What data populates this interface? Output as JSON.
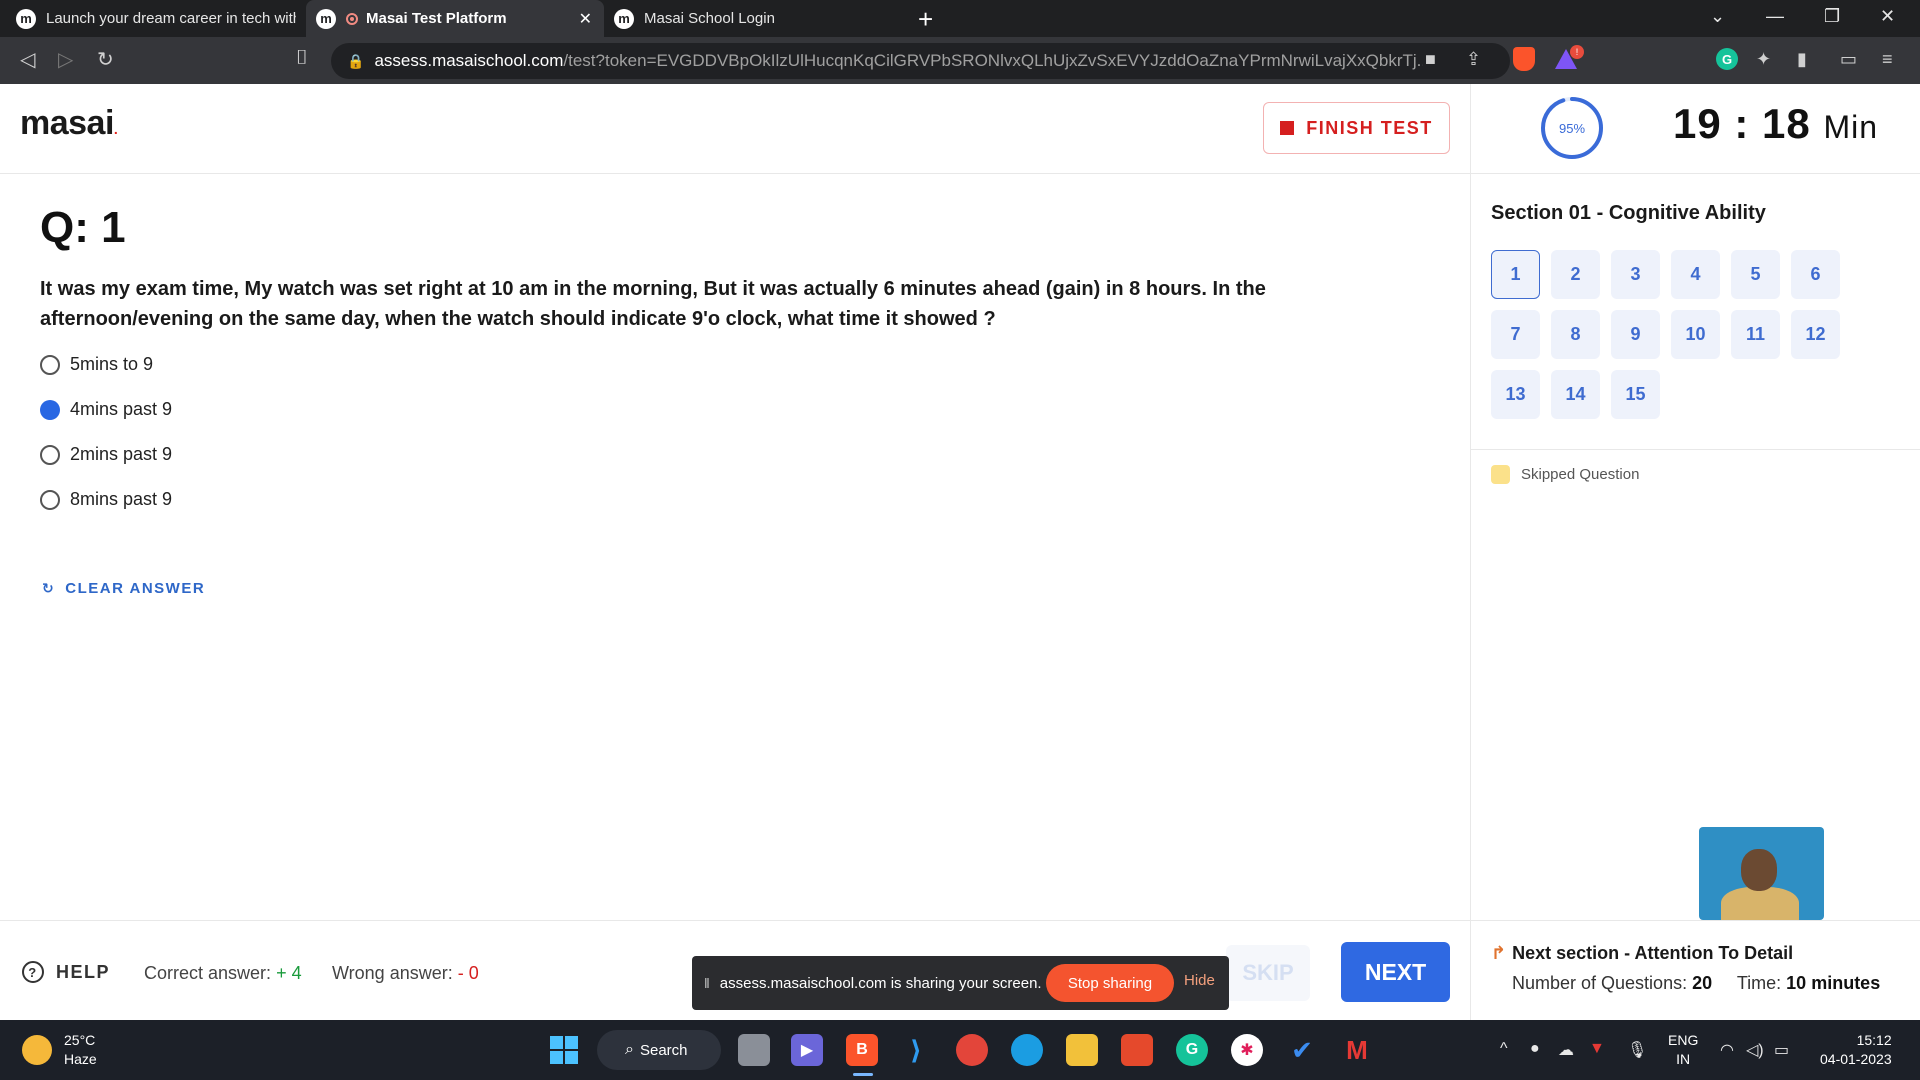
{
  "browser": {
    "tabs": [
      {
        "title": "Launch your dream career in tech with",
        "favicon": "m",
        "active": false
      },
      {
        "title": "Masai Test Platform",
        "favicon": "m",
        "active": true
      },
      {
        "title": "Masai School Login",
        "favicon": "m",
        "active": false
      }
    ],
    "url_host": "assess.masaischool.com",
    "url_path": "/test?token=EVGDDVBpOkIlzUlHucqnKqCilGRVPbSRONlvxQLhUjxZvSxEVYJzddOaZnaYPrmNrwiLvajXxQbkrTj...",
    "new_tab_icon": "plus-icon"
  },
  "header": {
    "logo_text": "masai",
    "finish_label": "FINISH TEST",
    "progress_label": "95%",
    "progress": 0.95,
    "timer_value": "19 : 18",
    "timer_unit": "Min"
  },
  "question": {
    "label": "Q: 1",
    "text": "It was my exam time, My watch was set right at 10 am in the morning, But it was actually 6 minutes ahead (gain) in 8 hours. In the afternoon/evening on the same day, when the watch should indicate 9'o clock, what time it showed ?",
    "options": [
      {
        "label": "5mins to 9",
        "selected": false
      },
      {
        "label": "4mins past 9",
        "selected": true
      },
      {
        "label": "2mins past 9",
        "selected": false
      },
      {
        "label": "8mins past 9",
        "selected": false
      }
    ],
    "clear_label": "CLEAR ANSWER"
  },
  "sidebar": {
    "section_title": "Section 01 - Cognitive Ability",
    "questions": [
      "1",
      "2",
      "3",
      "4",
      "5",
      "6",
      "7",
      "8",
      "9",
      "10",
      "11",
      "12",
      "13",
      "14",
      "15"
    ],
    "current_question": "1",
    "legend_label": "Skipped Question",
    "legend_color": "#fbe18a"
  },
  "footer": {
    "help_label": "HELP",
    "correct_label": "Correct answer:",
    "correct_value": "+ 4",
    "wrong_label": "Wrong answer:",
    "wrong_value": "- 0",
    "skip_label": "SKIP",
    "next_label": "NEXT",
    "next_section_title": "Next section - Attention To Detail",
    "num_questions_label": "Number of Questions:",
    "num_questions_value": "20",
    "time_label": "Time:",
    "time_value": "10 minutes"
  },
  "share_banner": {
    "message": "assess.masaischool.com is sharing your screen.",
    "stop_label": "Stop sharing",
    "hide_label": "Hide"
  },
  "taskbar": {
    "weather_temp": "25°C",
    "weather_desc": "Haze",
    "search_label": "Search",
    "lang_primary": "ENG",
    "lang_secondary": "IN",
    "time": "15:12",
    "date": "04-01-2023"
  },
  "colors": {
    "accent": "#2f69e2",
    "danger": "#d51f1f",
    "positive": "#1a9b3c"
  }
}
